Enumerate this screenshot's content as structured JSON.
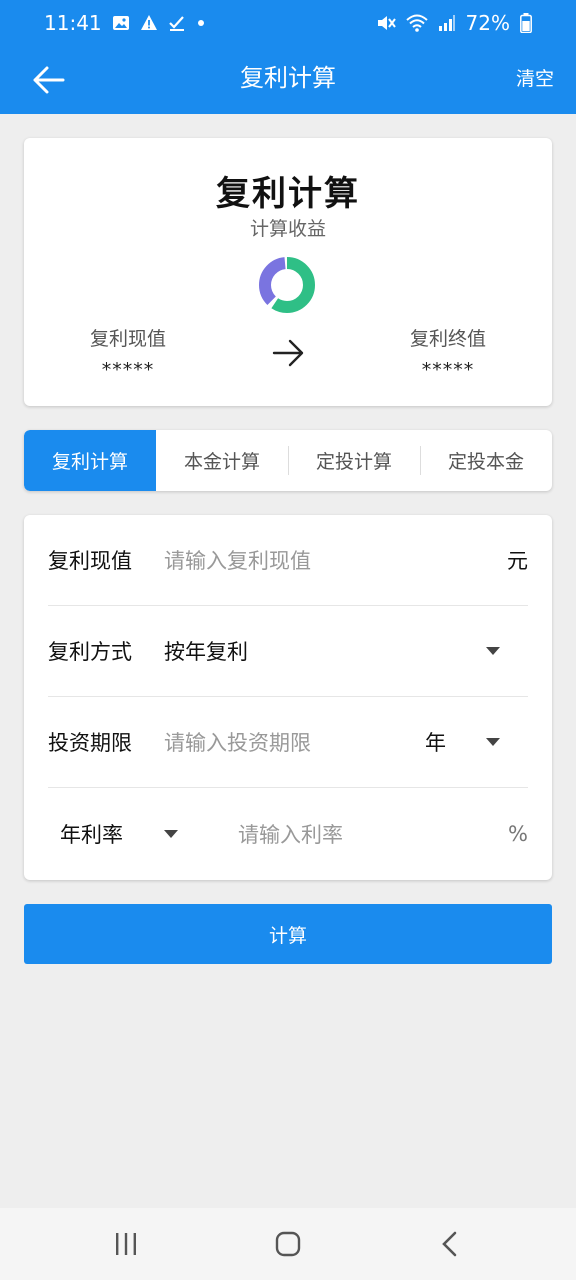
{
  "status": {
    "time": "11:41",
    "battery": "72%"
  },
  "appbar": {
    "title": "复利计算",
    "clear_label": "清空"
  },
  "summary": {
    "title": "复利计算",
    "subtitle": "计算收益",
    "left_label": "复利现值",
    "left_value": "*****",
    "right_label": "复利终值",
    "right_value": "*****",
    "donut_colors": {
      "green": "#2fbf86",
      "purple": "#7a74e0"
    }
  },
  "tabs": [
    {
      "label": "复利计算",
      "active": true
    },
    {
      "label": "本金计算",
      "active": false
    },
    {
      "label": "定投计算",
      "active": false
    },
    {
      "label": "定投本金",
      "active": false
    }
  ],
  "form": {
    "present_value": {
      "label": "复利现值",
      "placeholder": "请输入复利现值",
      "unit": "元"
    },
    "compound_mode": {
      "label": "复利方式",
      "value": "按年复利"
    },
    "period": {
      "label": "投资期限",
      "placeholder": "请输入投资期限",
      "unit": "年"
    },
    "rate": {
      "label": "年利率",
      "placeholder": "请输入利率",
      "unit": "%"
    }
  },
  "calculate_label": "计算",
  "colors": {
    "accent": "#1a8bee",
    "background": "#eeeeee"
  }
}
